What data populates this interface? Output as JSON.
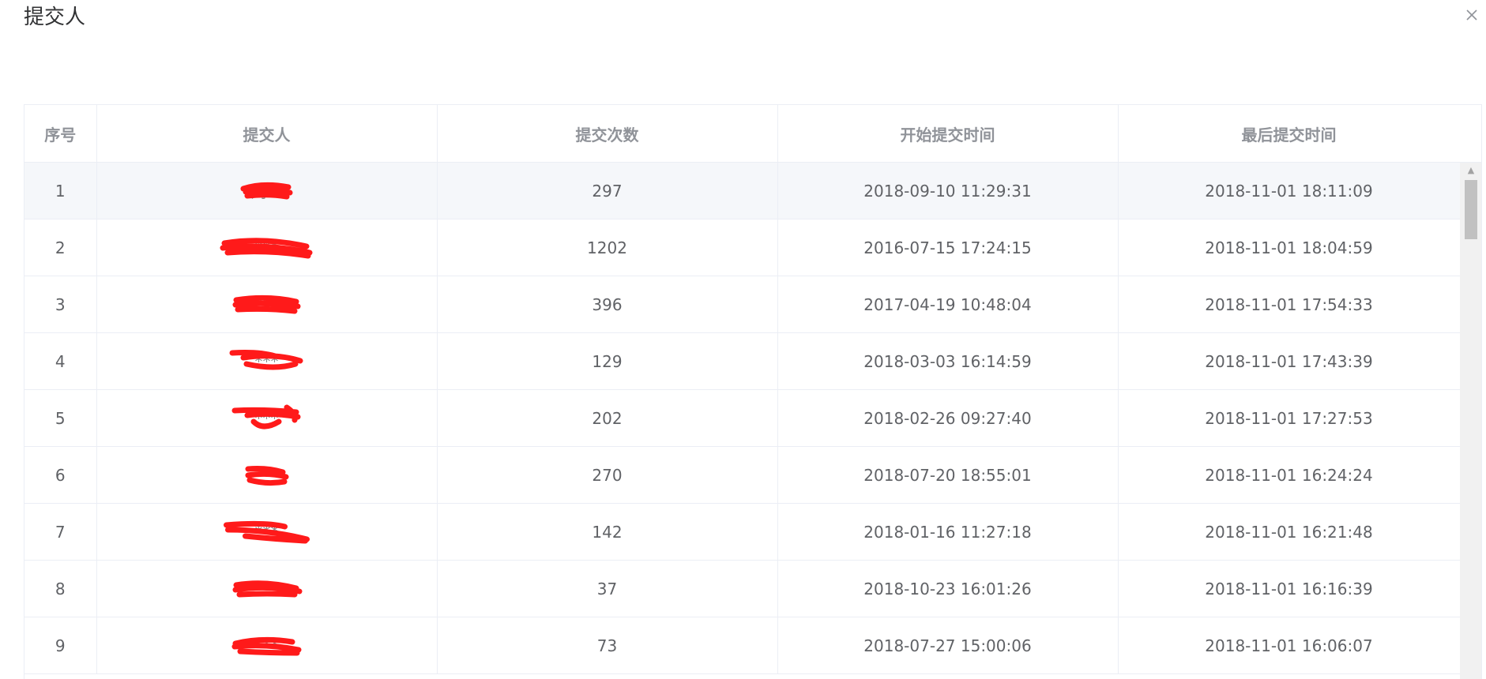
{
  "dialog": {
    "title": "提交人"
  },
  "table": {
    "headers": [
      "序号",
      "提交人",
      "提交次数",
      "开始提交时间",
      "最后提交时间"
    ],
    "rows": [
      {
        "index": "1",
        "submitter": "刘**",
        "count": "297",
        "start": "2018-09-10 11:29:31",
        "last": "2018-11-01 18:11:09"
      },
      {
        "index": "2",
        "submitter": "***",
        "count": "1202",
        "start": "2016-07-15 17:24:15",
        "last": "2018-11-01 18:04:59"
      },
      {
        "index": "3",
        "submitter": "***",
        "count": "396",
        "start": "2017-04-19 10:48:04",
        "last": "2018-11-01 17:54:33"
      },
      {
        "index": "4",
        "submitter": "***",
        "count": "129",
        "start": "2018-03-03 16:14:59",
        "last": "2018-11-01 17:43:39"
      },
      {
        "index": "5",
        "submitter": "***",
        "count": "202",
        "start": "2018-02-26 09:27:40",
        "last": "2018-11-01 17:27:53"
      },
      {
        "index": "6",
        "submitter": "**",
        "count": "270",
        "start": "2018-07-20 18:55:01",
        "last": "2018-11-01 16:24:24"
      },
      {
        "index": "7",
        "submitter": "***",
        "count": "142",
        "start": "2018-01-16 11:27:18",
        "last": "2018-11-01 16:21:48"
      },
      {
        "index": "8",
        "submitter": "***",
        "count": "37",
        "start": "2018-10-23 16:01:26",
        "last": "2018-11-01 16:16:39"
      },
      {
        "index": "9",
        "submitter": "***",
        "count": "73",
        "start": "2018-07-27 15:00:06",
        "last": "2018-11-01 16:06:07"
      }
    ]
  },
  "colors": {
    "header_text": "#909399",
    "cell_text": "#606266",
    "border": "#ebeef5",
    "hover_row": "#f5f7fa",
    "redaction": "#ff1a1a"
  },
  "icons": {
    "close": "close-icon",
    "scroll_up": "scroll-up-arrow-icon"
  }
}
